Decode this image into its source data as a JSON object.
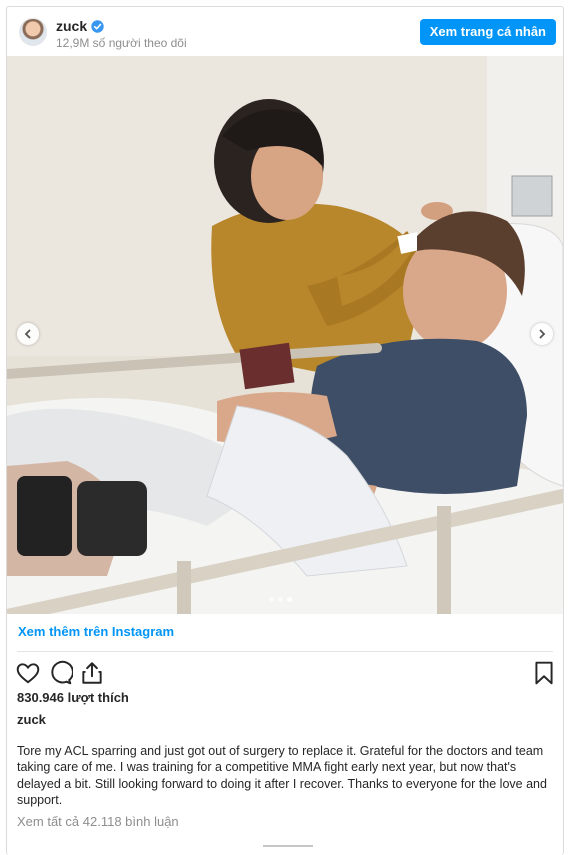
{
  "header": {
    "username": "zuck",
    "followers": "12,9M số người theo dõi",
    "profile_button": "Xem trang cá nhân"
  },
  "icons": {
    "verified": "verified-badge-icon",
    "prev": "chevron-left-icon",
    "next": "chevron-right-icon",
    "like": "heart-icon",
    "comment": "comment-icon",
    "share": "share-icon",
    "save": "bookmark-icon"
  },
  "colors": {
    "accent": "#0095f6",
    "text": "#262626",
    "muted": "#8e8e8e"
  },
  "carousel": {
    "slides": 3,
    "active_slide": 3
  },
  "footer": {
    "see_more": "Xem thêm trên Instagram",
    "likes": "830.946 lượt thích",
    "author": "zuck",
    "caption": "Tore my ACL sparring and just got out of surgery to replace it. Grateful for the doctors and team taking care of me. I was training for a competitive MMA fight early next year, but now that's delayed a bit. Still looking forward to doing it after I recover. Thanks to everyone for the love and support.",
    "comments": "Xem tất cả 42.118 bình luận"
  }
}
